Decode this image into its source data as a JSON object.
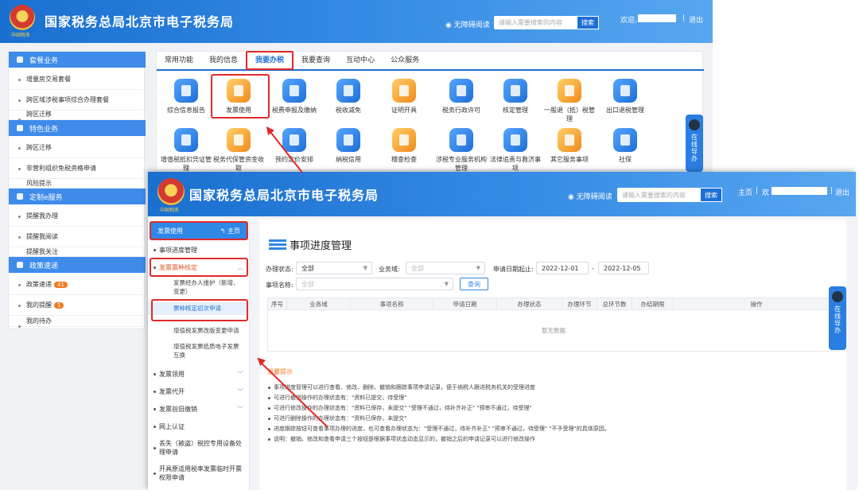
{
  "site_title": "国家税务总局北京市电子税务局",
  "emblem_caption": "中国税务",
  "back": {
    "accessibility": "无障碍阅读",
    "search_placeholder": "请输入需要搜索的内容",
    "search_btn": "搜索",
    "welcome": "欢迎,",
    "logout": "退出",
    "sep": "|",
    "left_sections": [
      {
        "title": "套餐业务",
        "items": [
          "增量房交易套餐",
          "跨区域涉税事项综合办理套餐",
          "跨区迁移"
        ]
      },
      {
        "title": "特色业务",
        "items": [
          "跨区迁移",
          "非营利组织免税资格申请",
          "风险提示"
        ]
      },
      {
        "title": "定制e服务",
        "items": [
          "提醒我办理",
          "提醒我阅读",
          "提醒我关注"
        ]
      },
      {
        "title": "政策速递",
        "items": [
          "政策速递",
          "我的提醒",
          "我的待办"
        ],
        "badges": [
          "41",
          "1",
          ""
        ]
      }
    ],
    "tabs": [
      "常用功能",
      "我的信息",
      "我要办税",
      "我要查询",
      "互动中心",
      "公众服务"
    ],
    "tiles_row1": [
      "综合信息报告",
      "发票使用",
      "税费申报及缴纳",
      "税收减免",
      "证明开具",
      "税务行政许可",
      "核定管理",
      "一般退（抵）税管理",
      "出口退税管理"
    ],
    "tiles_row2": [
      "增值税抵扣凭证管理",
      "税务代保管资金收取",
      "预约定价安排",
      "纳税信用",
      "稽查检查",
      "涉税专业服务机构管理",
      "法律追责与救济事项",
      "其它服务事项",
      "社保"
    ]
  },
  "online_guide": "在线导办",
  "front": {
    "accessibility": "无障碍阅读",
    "search_placeholder": "请输入需要搜索的内容",
    "search_btn": "搜索",
    "home": "主页",
    "welcome_prefix": "欢",
    "logout": "退出",
    "sep": "|",
    "sidebar": {
      "head": "发票使用",
      "home_link": "主页",
      "items": {
        "progress": "事项进度管理",
        "types_check": "发票票种核定",
        "operator": "发票经办人维护（新增、变更）",
        "first_apply": "票种核定初次申请",
        "vat_adjust": "增值税发票改版变更申请",
        "vat_paper": "增值税发票纸质电子发票互换",
        "invoice_use": "发票领用",
        "invoice_issue": "发票代开",
        "invoice_cancel": "发票验旧缴销",
        "online_auth": "网上认证",
        "lost": "丢失（被盗）税控专用设备处理申请",
        "special": "开具原适用税率发票临时开票权限申请"
      }
    },
    "content": {
      "title": "事项进度管理",
      "status_label": "办理状态:",
      "status_value": "全部",
      "domain_label": "业务域:",
      "domain_placeholder": "全部",
      "date_label": "申请日期起止:",
      "date_from": "2022-12-01",
      "date_sep": "-",
      "date_to": "2022-12-05",
      "item_label": "事项名称:",
      "item_placeholder": "全部",
      "query_btn": "查询",
      "columns": [
        "序号",
        "业务域",
        "事项名称",
        "申请日期",
        "办理状态",
        "办理环节",
        "总环节数",
        "办结期限",
        "操作"
      ],
      "empty_text": "暂无数据",
      "tips_title": "温馨提示",
      "tips": [
        "事项进度管理可以进行查看、修改、删除、撤销和跟踪事项申请记录，便于纳税人跟进税务机关的受理进度",
        "可进行撤销操作的办理状态有：\"资料已提交，待受理\"",
        "可进行修改操作的办理状态有：\"资料已保存，未提交\"  \"受理不通过，待补齐补正\"  \"预审不通过，待受理\"",
        "可进行删除操作的办理状态有：\"资料已保存，未提交\"",
        "进度跟踪按钮可查看事项办理的进度，也可查看办理状态为：\"受理不通过，待补齐补正\"  \"预审不通过，待受理\"  \"不予受理\"的具体原因。",
        "说明：撤销、修改和查看申请三个按钮是根据事项状态动态显示的，撤销之后的申请记录可以进行修改操作"
      ]
    }
  }
}
